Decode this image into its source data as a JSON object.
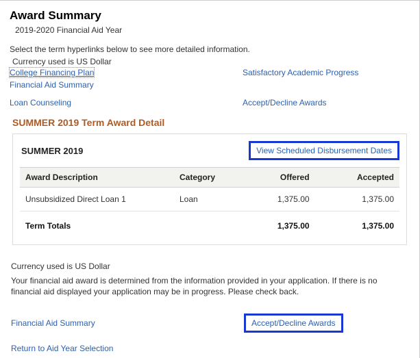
{
  "header": {
    "title": "Award Summary",
    "aid_year": "2019-2020 Financial Aid Year"
  },
  "instructions": "Select the term hyperlinks below to see more detailed information.",
  "currency_label": "Currency used is US Dollar",
  "links": {
    "college_financing_plan": "College Financing Plan",
    "satisfactory_progress": "Satisfactory Academic Progress",
    "fin_aid_summary": "Financial Aid Summary",
    "loan_counseling": "Loan Counseling",
    "accept_decline": "Accept/Decline Awards"
  },
  "term_detail": {
    "heading": "SUMMER 2019 Term Award Detail",
    "term_name": "SUMMER 2019",
    "view_disbursement": "View Scheduled Disbursement Dates",
    "columns": {
      "desc": "Award Description",
      "category": "Category",
      "offered": "Offered",
      "accepted": "Accepted"
    },
    "rows": [
      {
        "desc": "Unsubsidized Direct Loan 1",
        "category": "Loan",
        "offered": "1,375.00",
        "accepted": "1,375.00"
      }
    ],
    "totals": {
      "label": "Term Totals",
      "offered": "1,375.00",
      "accepted": "1,375.00"
    }
  },
  "footer": {
    "currency_label": "Currency used is US Dollar",
    "text": "Your financial aid award is determined from the information provided in your application. If there is no financial aid displayed your application may be in progress. Please check back.",
    "fin_aid_summary": "Financial Aid Summary",
    "accept_decline": "Accept/Decline Awards",
    "return": "Return to Aid Year Selection"
  }
}
